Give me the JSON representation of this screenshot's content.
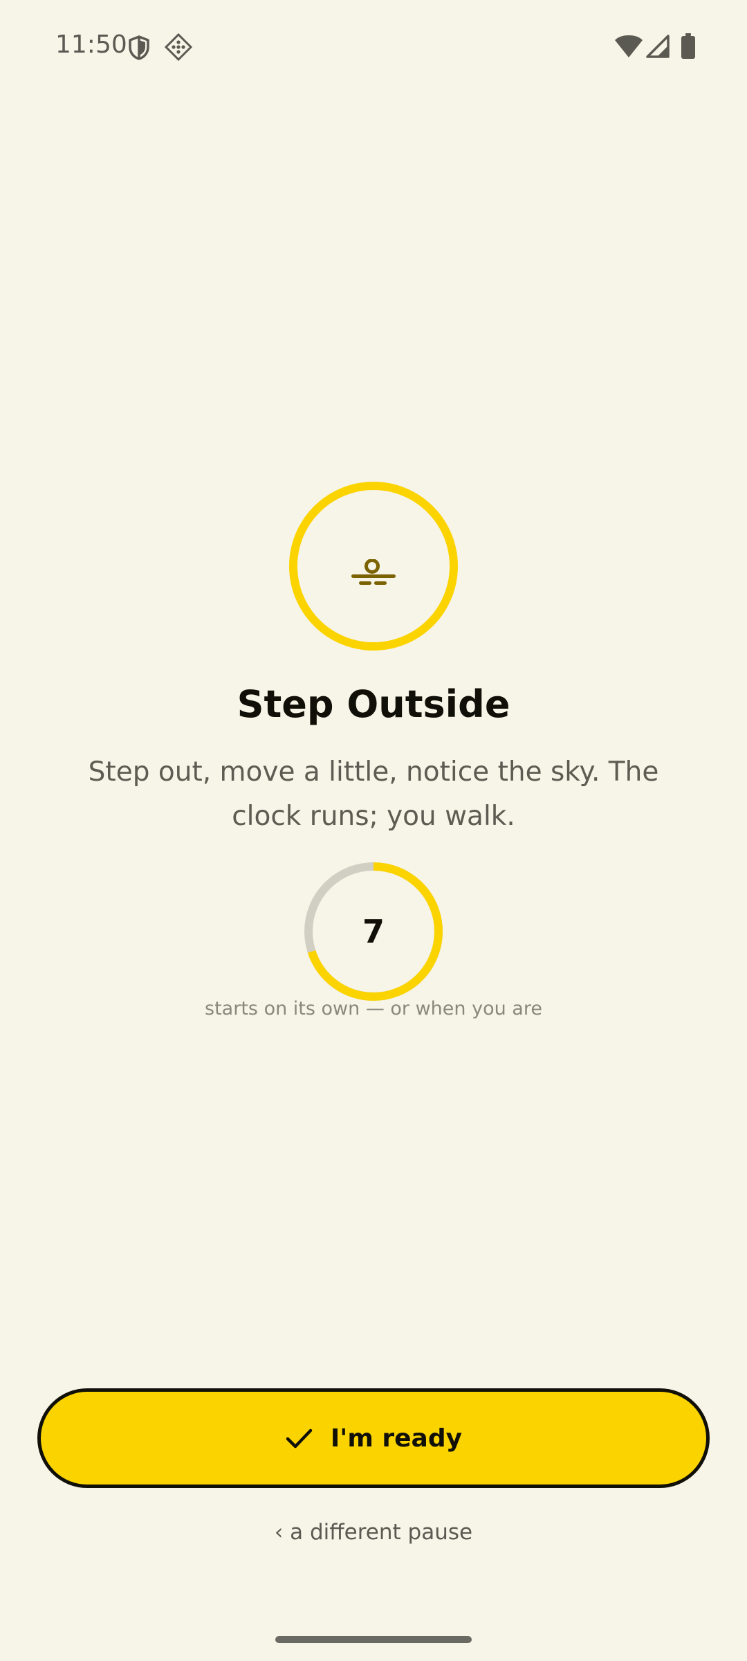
{
  "status_bar": {
    "time": "11:50",
    "icons": [
      "shield-icon",
      "app-notification-icon",
      "wifi-icon",
      "cellular-signal-icon",
      "battery-icon"
    ]
  },
  "activity": {
    "icon": "sun-horizon-icon",
    "title": "Step Outside",
    "description": "Step out, move a little, notice the sky. The clock runs; you walk."
  },
  "countdown": {
    "value": "7",
    "progress_fraction": 0.7,
    "caption": "starts on its own — or when you are"
  },
  "actions": {
    "ready_label": "I'm ready",
    "ready_icon": "check-icon",
    "different_pause_label": "‹ a different pause"
  },
  "colors": {
    "background": "#F7F4E8",
    "accent": "#FBD400",
    "track": "#D1CEC4",
    "icon_dark": "#7A6300",
    "text": "#111008"
  }
}
